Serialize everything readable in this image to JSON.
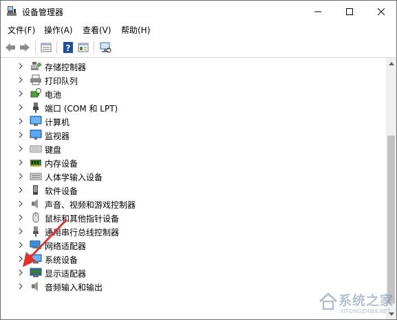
{
  "window": {
    "title": "设备管理器"
  },
  "menu": [
    "文件(F)",
    "操作(A)",
    "查看(V)",
    "帮助(H)"
  ],
  "toolbar": [
    "back-icon",
    "forward-icon",
    "properties-icon",
    "help-icon",
    "view-icon",
    "scan-hardware-icon"
  ],
  "tree": [
    {
      "label": "存储控制器",
      "icon": "storage-controller-icon"
    },
    {
      "label": "打印队列",
      "icon": "printer-icon"
    },
    {
      "label": "电池",
      "icon": "battery-icon"
    },
    {
      "label": "端口 (COM 和 LPT)",
      "icon": "port-icon"
    },
    {
      "label": "计算机",
      "icon": "computer-icon"
    },
    {
      "label": "监视器",
      "icon": "monitor-icon"
    },
    {
      "label": "键盘",
      "icon": "keyboard-icon"
    },
    {
      "label": "内存设备",
      "icon": "memory-icon"
    },
    {
      "label": "人体学输入设备",
      "icon": "hid-icon"
    },
    {
      "label": "软件设备",
      "icon": "software-device-icon"
    },
    {
      "label": "声音、视频和游戏控制器",
      "icon": "speaker-icon"
    },
    {
      "label": "鼠标和其他指针设备",
      "icon": "mouse-icon"
    },
    {
      "label": "通用串行总线控制器",
      "icon": "usb-icon"
    },
    {
      "label": "网络适配器",
      "icon": "network-icon"
    },
    {
      "label": "系统设备",
      "icon": "system-device-icon"
    },
    {
      "label": "显示适配器",
      "icon": "display-adapter-icon"
    },
    {
      "label": "音频输入和输出",
      "icon": "audio-io-icon"
    }
  ],
  "watermark": {
    "text": "系统之家",
    "sub": "XITONGZHIJIA.NET"
  },
  "colors": {
    "accent": "#1e78d7",
    "annotation_arrow": "#e5302a"
  }
}
